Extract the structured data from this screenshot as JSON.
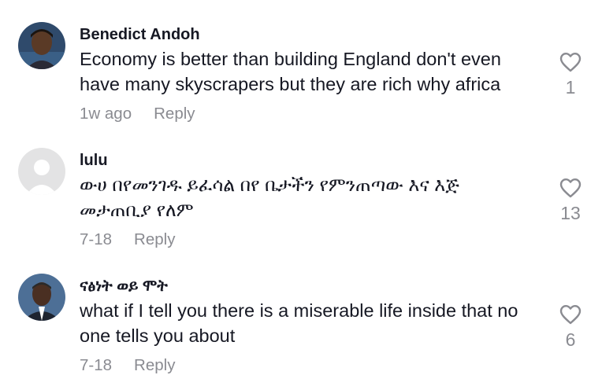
{
  "comments": [
    {
      "username": "Benedict Andoh",
      "text": "Economy is better than building England don't even have many skyscrapers but they are rich why africa",
      "time": "1w ago",
      "reply_label": "Reply",
      "likes": "1",
      "avatar_icon": "user-photo-avatar"
    },
    {
      "username": "lulu",
      "text": "ውሀ በየመንገዱ ይፈሳል በየ ቤታችን የምንጠጣው እና እጅ መታጠቢያ የለም",
      "time": "7-18",
      "reply_label": "Reply",
      "likes": "13",
      "avatar_icon": "default-user-avatar"
    },
    {
      "username": "ናፅነት ወይ ሞት",
      "text": "what if I tell you there is a miserable life inside that no one tells you about",
      "time": "7-18",
      "reply_label": "Reply",
      "likes": "6",
      "avatar_icon": "user-photo-avatar"
    }
  ],
  "colors": {
    "text": "#161823",
    "muted": "#8a8b91",
    "default_avatar_bg": "#e3e3e4"
  }
}
